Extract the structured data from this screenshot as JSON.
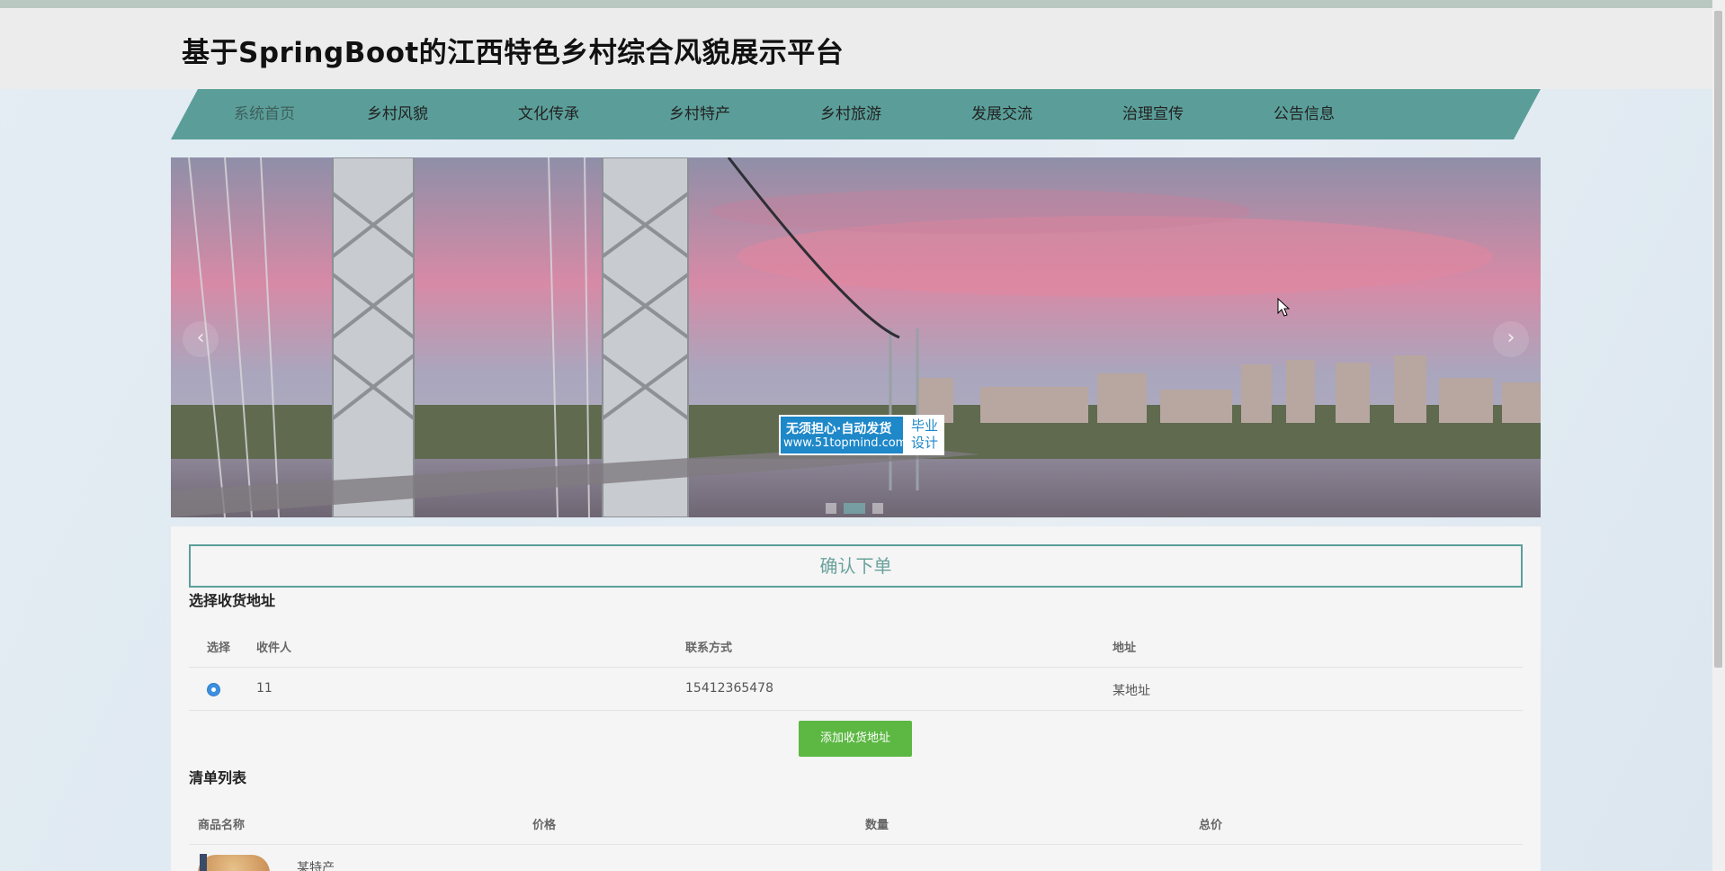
{
  "site": {
    "title": "基于SpringBoot的江西特色乡村综合风貌展示平台"
  },
  "nav": {
    "items": [
      {
        "label": "系统首页",
        "name": "nav-home",
        "active": true
      },
      {
        "label": "乡村风貌",
        "name": "nav-rural-scenery",
        "active": false
      },
      {
        "label": "文化传承",
        "name": "nav-culture",
        "active": false
      },
      {
        "label": "乡村特产",
        "name": "nav-specialty",
        "active": false
      },
      {
        "label": "乡村旅游",
        "name": "nav-tourism",
        "active": false
      },
      {
        "label": "发展交流",
        "name": "nav-development",
        "active": false
      },
      {
        "label": "治理宣传",
        "name": "nav-governance",
        "active": false
      },
      {
        "label": "公告信息",
        "name": "nav-notice",
        "active": false
      }
    ]
  },
  "carousel": {
    "prev_icon": "‹",
    "next_icon": "›",
    "slide_count": 3,
    "active_slide": 2
  },
  "watermark": {
    "line1": "无须担心·自动发货",
    "line2": "www.51topmind.com",
    "right1": "毕业",
    "right2": "设计"
  },
  "order": {
    "confirm_label": "确认下单",
    "address_section_title": "选择收货地址",
    "address_headers": [
      "选择",
      "收件人",
      "联系方式",
      "地址"
    ],
    "addresses": [
      {
        "selected": true,
        "recipient": "11",
        "phone": "15412365478",
        "address": "某地址"
      }
    ],
    "add_address_label": "添加收货地址",
    "items_section_title": "清单列表",
    "item_headers": [
      "商品名称",
      "价格",
      "数量",
      "总价"
    ],
    "items": [
      {
        "name": "某特产"
      }
    ]
  },
  "colors": {
    "accent": "#5b9e99",
    "add_button": "#5cb843",
    "radio": "#3d8fe0"
  }
}
